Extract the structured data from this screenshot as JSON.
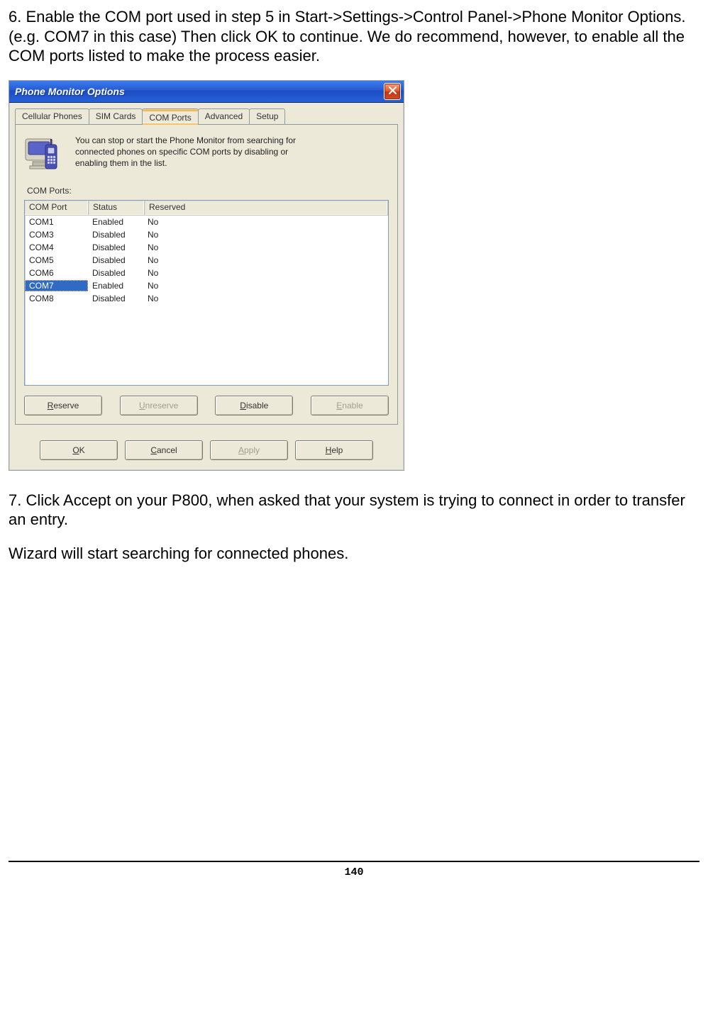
{
  "doc": {
    "para6": "6. Enable the COM port used in step 5 in Start->Settings->Control Panel->Phone Monitor Options. (e.g. COM7 in this case) Then click OK to continue. We do recommend, however, to enable all the COM ports listed to make the process easier.",
    "para7": "7. Click Accept on your P800, when asked that your system is trying to connect in order to transfer an entry.",
    "para8": "Wizard will start searching for connected phones.",
    "page_number": "140"
  },
  "dialog": {
    "title": "Phone Monitor Options",
    "tabs": [
      "Cellular Phones",
      "SIM Cards",
      "COM Ports",
      "Advanced",
      "Setup"
    ],
    "active_tab_index": 2,
    "intro": "You can stop or start the Phone Monitor from searching for connected phones on specific COM ports by disabling or enabling them in the list.",
    "list_label": "COM Ports:",
    "columns": {
      "port": "COM Port",
      "status": "Status",
      "reserved": "Reserved"
    },
    "rows": [
      {
        "port": "COM1",
        "status": "Enabled",
        "reserved": "No",
        "selected": false
      },
      {
        "port": "COM3",
        "status": "Disabled",
        "reserved": "No",
        "selected": false
      },
      {
        "port": "COM4",
        "status": "Disabled",
        "reserved": "No",
        "selected": false
      },
      {
        "port": "COM5",
        "status": "Disabled",
        "reserved": "No",
        "selected": false
      },
      {
        "port": "COM6",
        "status": "Disabled",
        "reserved": "No",
        "selected": false
      },
      {
        "port": "COM7",
        "status": "Enabled",
        "reserved": "No",
        "selected": true
      },
      {
        "port": "COM8",
        "status": "Disabled",
        "reserved": "No",
        "selected": false
      }
    ],
    "action_buttons": {
      "reserve": {
        "label": "Reserve",
        "hot": "R",
        "disabled": false
      },
      "unreserve": {
        "label": "Unreserve",
        "hot": "U",
        "disabled": true
      },
      "disable": {
        "label": "Disable",
        "hot": "D",
        "disabled": false
      },
      "enable": {
        "label": "Enable",
        "hot": "E",
        "disabled": true
      }
    },
    "bottom_buttons": {
      "ok": {
        "label": "OK",
        "hot": "O",
        "disabled": false
      },
      "cancel": {
        "label": "Cancel",
        "hot": "C",
        "disabled": false
      },
      "apply": {
        "label": "Apply",
        "hot": "A",
        "disabled": true
      },
      "help": {
        "label": "Help",
        "hot": "H",
        "disabled": false
      }
    }
  }
}
